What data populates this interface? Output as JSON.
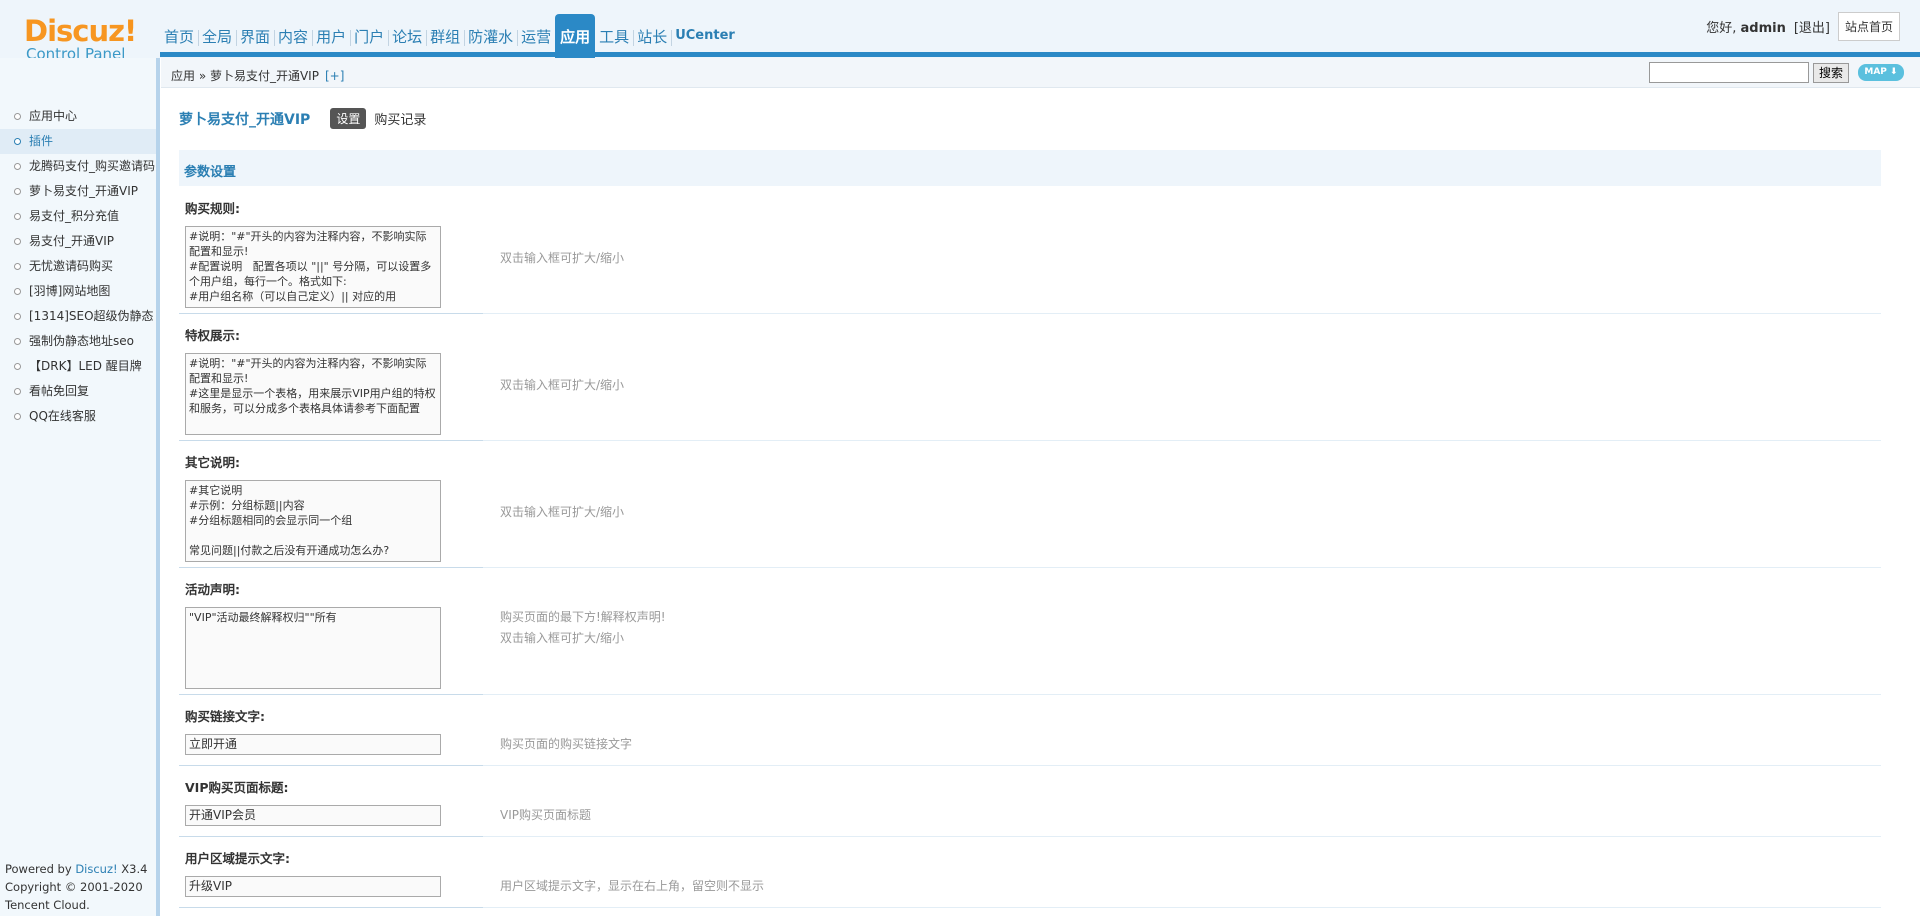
{
  "header": {
    "logo_brand": "Discuz",
    "logo_bang": "!",
    "logo_sub": "Control Panel",
    "nav": [
      "首页",
      "全局",
      "界面",
      "内容",
      "用户",
      "门户",
      "论坛",
      "群组",
      "防灌水",
      "运营",
      "应用",
      "工具",
      "站长",
      "UCenter"
    ],
    "active_nav_index": 10,
    "greeting": "您好,",
    "username": "admin",
    "logout": "[退出]",
    "site_home": "站点首页"
  },
  "sidebar": {
    "items": [
      "应用中心",
      "插件",
      "龙腾码支付_购买邀请码",
      "萝卜易支付_开通VIP",
      "易支付_积分充值",
      "易支付_开通VIP",
      "无忧邀请码购买",
      "[羽博]网站地图",
      "[1314]SEO超级伪静态",
      "强制伪静态地址seo",
      "【DRK】LED 醒目牌",
      "看帖免回复",
      "QQ在线客服"
    ],
    "current_index": 1,
    "powered_prefix": "Powered by ",
    "powered_brand": "Discuz!",
    "powered_version": " X3.4",
    "copyright": "Copyright © 2001-2020",
    "company": "Tencent Cloud."
  },
  "breadcrumb": {
    "path": "应用 » 萝卜易支付_开通VIP",
    "plus": "[+]",
    "search_button": "搜索",
    "map_button": "MAP ⬇"
  },
  "page": {
    "title": "萝卜易支付_开通VIP",
    "tab_active": "设置",
    "tab_other": "购买记录",
    "section_title": "参数设置"
  },
  "fields": {
    "rule": {
      "label": "购买规则:",
      "value": "#说明：\"#\"开头的内容为注释内容，不影响实际配置和显示!\n#配置说明   配置各项以 \"||\" 号分隔，可以设置多个用户组，每行一个。格式如下:\n#用户组名称（可以自己定义）|| 对应的用",
      "tip": "双击输入框可扩大/缩小"
    },
    "privilege": {
      "label": "特权展示:",
      "value": "#说明：\"#\"开头的内容为注释内容，不影响实际配置和显示!\n#这里是显示一个表格，用来展示VIP用户组的特权和服务，可以分成多个表格具体请参考下面配置",
      "tip": "双击输入框可扩大/缩小"
    },
    "other": {
      "label": "其它说明:",
      "value": "#其它说明\n#示例：分组标题||内容\n#分组标题相同的会显示同一个组\n\n常见问题||付款之后没有开通成功怎么办?",
      "tip": "双击输入框可扩大/缩小"
    },
    "activity": {
      "label": "活动声明:",
      "value": "\"VIP\"活动最终解释权归\"\"所有",
      "tip1": "购买页面的最下方!解释权声明!",
      "tip2": "双击输入框可扩大/缩小"
    },
    "link_text": {
      "label": "购买链接文字:",
      "value": "立即开通",
      "tip": "购买页面的购买链接文字"
    },
    "vip_title": {
      "label": "VIP购买页面标题:",
      "value": "开通VIP会员",
      "tip": "VIP购买页面标题"
    },
    "user_tip": {
      "label": "用户区域提示文字:",
      "value": "升级VIP",
      "tip": "用户区域提示文字，显示在右上角，留空则不显示"
    }
  }
}
